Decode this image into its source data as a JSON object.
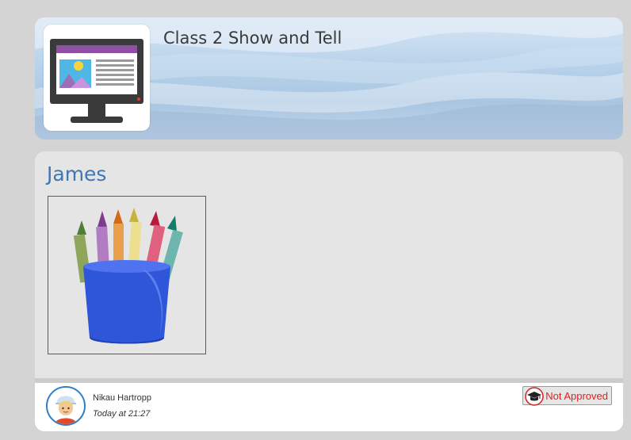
{
  "banner": {
    "title": "Class 2 Show and Tell",
    "icon": "computer-monitor-icon"
  },
  "post": {
    "author_heading": "James",
    "image_icon": "crayons-in-cup-image",
    "footer": {
      "poster_name": "Nikau Hartropp",
      "timestamp": "Today at 21:27",
      "avatar_icon": "student-avatar-icon",
      "status_label": "Not Approved",
      "status_icon": "graduation-cap-icon"
    }
  },
  "colors": {
    "background": "#d4d4d4",
    "author_heading": "#3e78b4",
    "status_text": "#e02020",
    "card_background": "#e5e5e5"
  }
}
